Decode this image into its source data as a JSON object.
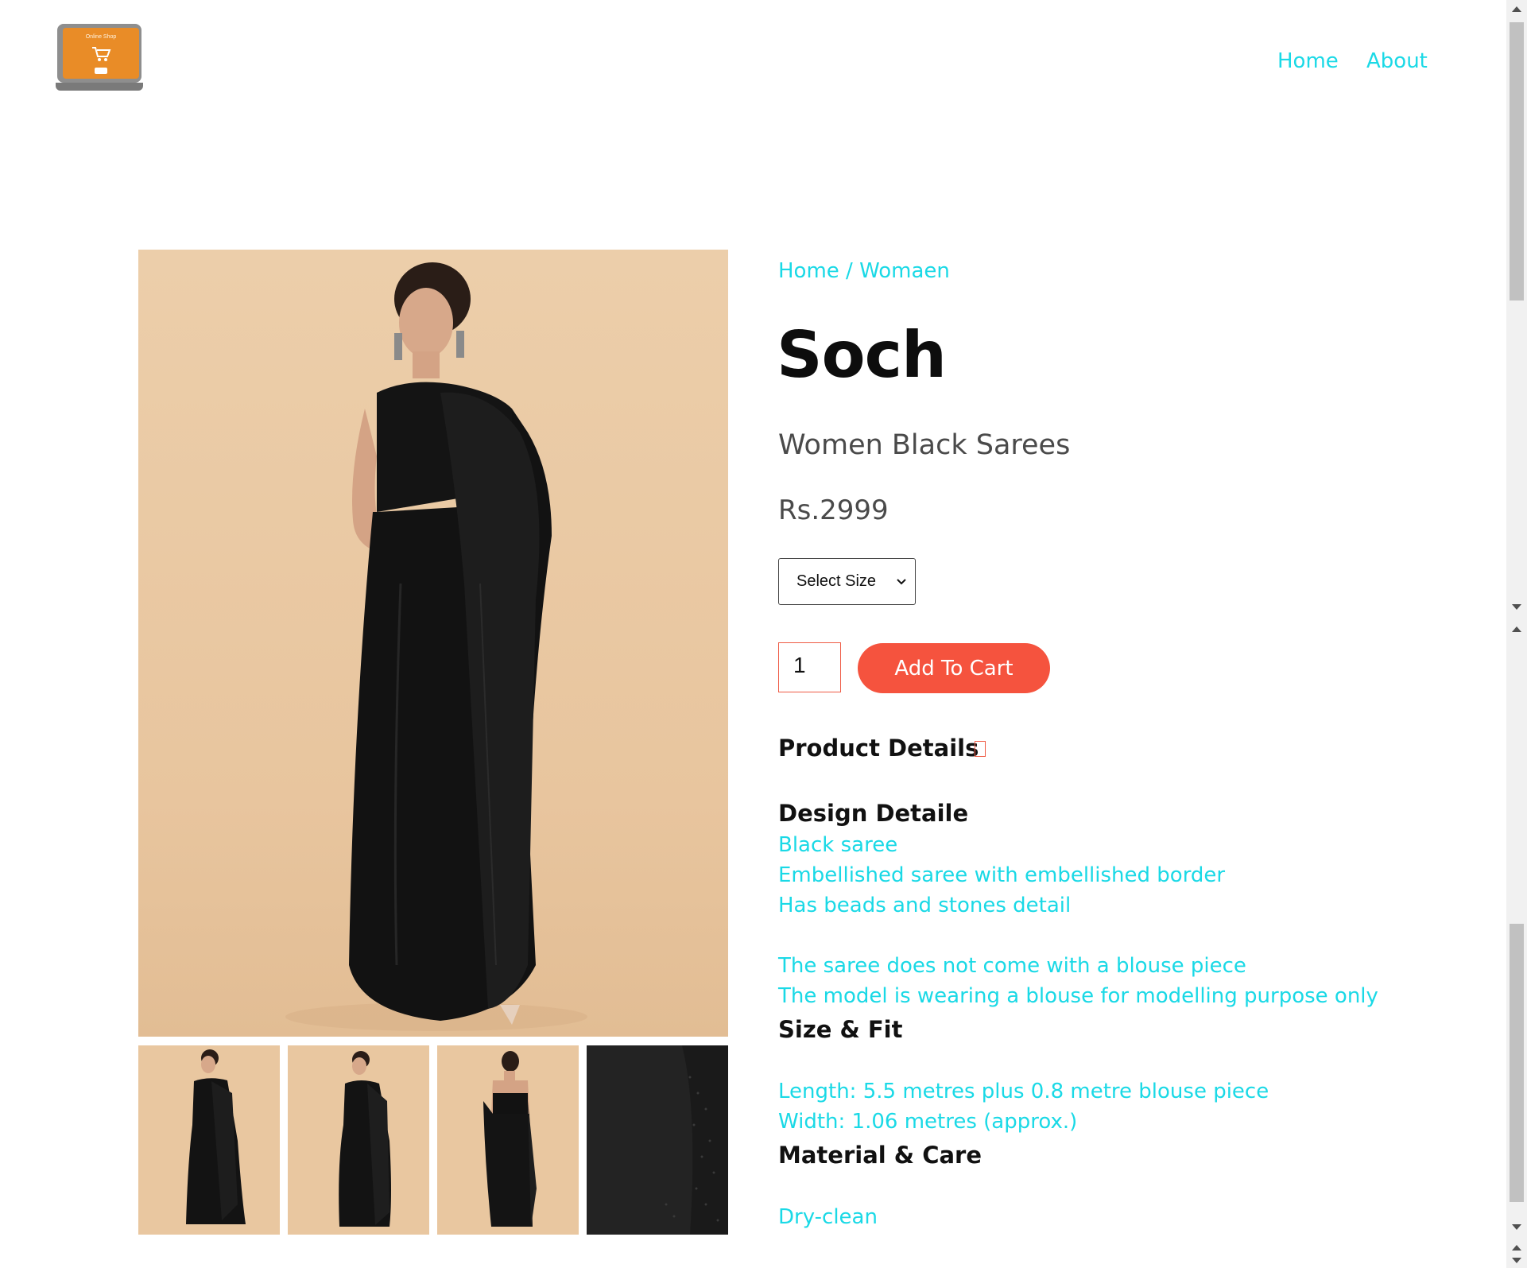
{
  "logo": {
    "text": "Online Shop",
    "button_text": "Buy"
  },
  "nav": {
    "home": "Home",
    "about": "About"
  },
  "breadcrumb": "Home / Womaen",
  "product": {
    "brand": "Soch",
    "name": "Women Black Sarees",
    "price": "Rs.2999",
    "size_select": "Select Size",
    "quantity": "1",
    "add_to_cart": "Add To Cart"
  },
  "details": {
    "heading": "Product Details",
    "design_title": "Design Detaile",
    "design_lines": [
      "Black saree",
      "Embellished saree with embellished border",
      "Has beads and stones detail",
      "The saree does not come with a blouse piece",
      "The model is wearing a blouse for modelling purpose only"
    ],
    "size_title": "Size & Fit",
    "size_lines": [
      "Length: 5.5 metres plus 0.8 metre blouse piece",
      "Width: 1.06 metres (approx.)"
    ],
    "material_title": "Material & Care",
    "material_lines": [
      "Dry-clean"
    ]
  },
  "colors": {
    "accent": "#1ad9e6",
    "cart_button": "#f5533e",
    "logo_orange": "#e98c27"
  },
  "icons": {
    "details_toggle": "square-outline-icon",
    "cart": "cart-icon"
  }
}
